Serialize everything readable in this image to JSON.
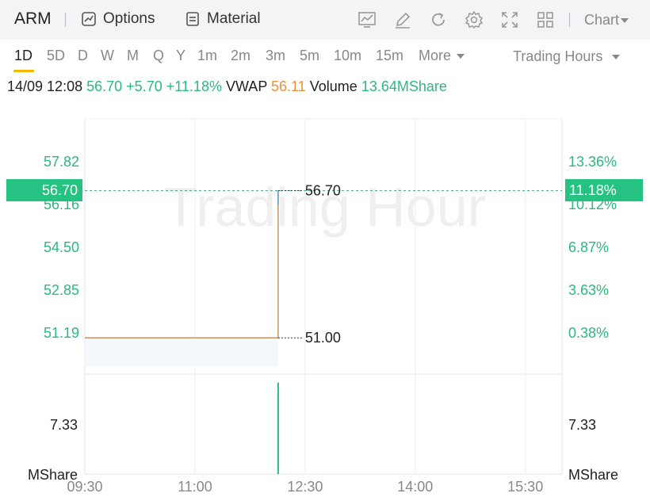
{
  "header": {
    "symbol": "ARM",
    "options_label": "Options",
    "material_label": "Material",
    "chart_label": "Chart",
    "icons": [
      "trend-icon",
      "draw-icon",
      "refresh-icon",
      "settings-icon",
      "fullscreen-icon",
      "layout-icon"
    ]
  },
  "periods": {
    "items": [
      "1D",
      "5D",
      "D",
      "W",
      "M",
      "Q",
      "Y",
      "1m",
      "2m",
      "3m",
      "5m",
      "10m",
      "15m",
      "More"
    ],
    "active": "1D",
    "session_label": "Trading Hours"
  },
  "info": {
    "datetime": "14/09 12:08",
    "price": "56.70",
    "change": "+5.70",
    "change_pct": "+11.18%",
    "vwap_label": "VWAP",
    "vwap": "56.11",
    "volume_label": "Volume",
    "volume": "13.64MShare"
  },
  "colors": {
    "up": "#2db87d",
    "highlight": "#26c281",
    "price_line": "#c89b6a",
    "vwap": "#e9923a",
    "volume_bar": "#2db87d"
  },
  "chart_data": {
    "type": "line",
    "watermark": "Trading Hour",
    "price_axis": {
      "ticks": [
        "57.82",
        "56.16",
        "54.50",
        "52.85",
        "51.19"
      ],
      "pct_ticks": [
        "13.36%",
        "10.12%",
        "6.87%",
        "3.63%",
        "0.38%"
      ],
      "current": "56.70",
      "current_pct": "11.18%"
    },
    "x_ticks": [
      "09:30",
      "11:00",
      "12:30",
      "14:00",
      "15:30"
    ],
    "series": [
      {
        "x": [
          "09:30",
          "12:08",
          "12:08"
        ],
        "y": [
          51.0,
          51.0,
          56.7
        ]
      }
    ],
    "markers": [
      {
        "label": "56.70",
        "value": 56.7
      },
      {
        "label": "51.00",
        "value": 51.0
      }
    ],
    "volume": {
      "tick": "7.33",
      "unit": "MShare",
      "bars": [
        {
          "x": "12:08",
          "value": 13.64
        }
      ]
    }
  }
}
